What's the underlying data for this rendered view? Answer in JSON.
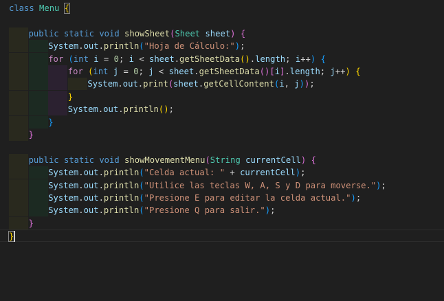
{
  "editor": {
    "language": "java",
    "colors": {
      "background": "#1f1f1f",
      "keyword": "#569cd6",
      "control": "#c586c0",
      "type": "#4ec9b0",
      "function": "#dcdcaa",
      "variable": "#9cdcfe",
      "string": "#ce9178",
      "number": "#b5cea8",
      "bracket_level_1": "#ffd700",
      "bracket_level_2": "#da70d6",
      "bracket_level_3": "#179fff"
    },
    "lines": [
      {
        "tokens": [
          [
            "kw",
            "class"
          ],
          [
            "pl",
            " "
          ],
          [
            "cls",
            "Menu"
          ],
          [
            "pl",
            " "
          ],
          [
            "bb1",
            "{"
          ]
        ]
      },
      {
        "tokens": []
      },
      {
        "tokens": [
          [
            "kw",
            "public"
          ],
          [
            "pl",
            " "
          ],
          [
            "kw",
            "static"
          ],
          [
            "pl",
            " "
          ],
          [
            "kw",
            "void"
          ],
          [
            "pl",
            " "
          ],
          [
            "fn",
            "showSheet"
          ],
          [
            "b2",
            "("
          ],
          [
            "ty",
            "Sheet"
          ],
          [
            "pl",
            " "
          ],
          [
            "var",
            "sheet"
          ],
          [
            "b2",
            ")"
          ],
          [
            "pl",
            " "
          ],
          [
            "b2",
            "{"
          ]
        ]
      },
      {
        "tokens": [
          [
            "var",
            "System"
          ],
          [
            "pl",
            "."
          ],
          [
            "var",
            "out"
          ],
          [
            "pl",
            "."
          ],
          [
            "fn",
            "println"
          ],
          [
            "b3",
            "("
          ],
          [
            "str",
            "\"Hoja de Cálculo:\""
          ],
          [
            "b3",
            ")"
          ],
          [
            "pl",
            ";"
          ]
        ]
      },
      {
        "tokens": [
          [
            "ctl",
            "for"
          ],
          [
            "pl",
            " "
          ],
          [
            "b3",
            "("
          ],
          [
            "kw",
            "int"
          ],
          [
            "pl",
            " "
          ],
          [
            "var",
            "i"
          ],
          [
            "pl",
            " = "
          ],
          [
            "num",
            "0"
          ],
          [
            "pl",
            "; "
          ],
          [
            "var",
            "i"
          ],
          [
            "pl",
            " < "
          ],
          [
            "var",
            "sheet"
          ],
          [
            "pl",
            "."
          ],
          [
            "fn",
            "getSheetData"
          ],
          [
            "b1",
            "()"
          ],
          [
            "pl",
            "."
          ],
          [
            "var",
            "length"
          ],
          [
            "pl",
            "; "
          ],
          [
            "var",
            "i"
          ],
          [
            "pl",
            "++"
          ],
          [
            "b3",
            ")"
          ],
          [
            "pl",
            " "
          ],
          [
            "b3",
            "{"
          ]
        ]
      },
      {
        "tokens": [
          [
            "ctl",
            "for"
          ],
          [
            "pl",
            " "
          ],
          [
            "b1",
            "("
          ],
          [
            "kw",
            "int"
          ],
          [
            "pl",
            " "
          ],
          [
            "var",
            "j"
          ],
          [
            "pl",
            " = "
          ],
          [
            "num",
            "0"
          ],
          [
            "pl",
            "; "
          ],
          [
            "var",
            "j"
          ],
          [
            "pl",
            " < "
          ],
          [
            "var",
            "sheet"
          ],
          [
            "pl",
            "."
          ],
          [
            "fn",
            "getSheetData"
          ],
          [
            "b2",
            "()"
          ],
          [
            "b2",
            "["
          ],
          [
            "var",
            "i"
          ],
          [
            "b2",
            "]"
          ],
          [
            "pl",
            "."
          ],
          [
            "var",
            "length"
          ],
          [
            "pl",
            "; "
          ],
          [
            "var",
            "j"
          ],
          [
            "pl",
            "++"
          ],
          [
            "b1",
            ")"
          ],
          [
            "pl",
            " "
          ],
          [
            "b1",
            "{"
          ]
        ]
      },
      {
        "tokens": [
          [
            "var",
            "System"
          ],
          [
            "pl",
            "."
          ],
          [
            "var",
            "out"
          ],
          [
            "pl",
            "."
          ],
          [
            "fn",
            "print"
          ],
          [
            "b2",
            "("
          ],
          [
            "var",
            "sheet"
          ],
          [
            "pl",
            "."
          ],
          [
            "fn",
            "getCellContent"
          ],
          [
            "b3",
            "("
          ],
          [
            "var",
            "i"
          ],
          [
            "pl",
            ", "
          ],
          [
            "var",
            "j"
          ],
          [
            "b3",
            ")"
          ],
          [
            "b2",
            ")"
          ],
          [
            "pl",
            ";"
          ]
        ]
      },
      {
        "tokens": [
          [
            "b1",
            "}"
          ]
        ]
      },
      {
        "tokens": [
          [
            "var",
            "System"
          ],
          [
            "pl",
            "."
          ],
          [
            "var",
            "out"
          ],
          [
            "pl",
            "."
          ],
          [
            "fn",
            "println"
          ],
          [
            "b1",
            "()"
          ],
          [
            "pl",
            ";"
          ]
        ]
      },
      {
        "tokens": [
          [
            "b3",
            "}"
          ]
        ]
      },
      {
        "tokens": [
          [
            "b2",
            "}"
          ]
        ]
      },
      {
        "tokens": []
      },
      {
        "tokens": [
          [
            "kw",
            "public"
          ],
          [
            "pl",
            " "
          ],
          [
            "kw",
            "static"
          ],
          [
            "pl",
            " "
          ],
          [
            "kw",
            "void"
          ],
          [
            "pl",
            " "
          ],
          [
            "fn",
            "showMovementMenu"
          ],
          [
            "b2",
            "("
          ],
          [
            "ty",
            "String"
          ],
          [
            "pl",
            " "
          ],
          [
            "var",
            "currentCell"
          ],
          [
            "b2",
            ")"
          ],
          [
            "pl",
            " "
          ],
          [
            "b2",
            "{"
          ]
        ]
      },
      {
        "tokens": [
          [
            "var",
            "System"
          ],
          [
            "pl",
            "."
          ],
          [
            "var",
            "out"
          ],
          [
            "pl",
            "."
          ],
          [
            "fn",
            "println"
          ],
          [
            "b3",
            "("
          ],
          [
            "str",
            "\"Celda actual: \""
          ],
          [
            "pl",
            " + "
          ],
          [
            "var",
            "currentCell"
          ],
          [
            "b3",
            ")"
          ],
          [
            "pl",
            ";"
          ]
        ]
      },
      {
        "tokens": [
          [
            "var",
            "System"
          ],
          [
            "pl",
            "."
          ],
          [
            "var",
            "out"
          ],
          [
            "pl",
            "."
          ],
          [
            "fn",
            "println"
          ],
          [
            "b3",
            "("
          ],
          [
            "str",
            "\"Utilice las teclas W, A, S y D para moverse.\""
          ],
          [
            "b3",
            ")"
          ],
          [
            "pl",
            ";"
          ]
        ]
      },
      {
        "tokens": [
          [
            "var",
            "System"
          ],
          [
            "pl",
            "."
          ],
          [
            "var",
            "out"
          ],
          [
            "pl",
            "."
          ],
          [
            "fn",
            "println"
          ],
          [
            "b3",
            "("
          ],
          [
            "str",
            "\"Presione E para editar la celda actual.\""
          ],
          [
            "b3",
            ")"
          ],
          [
            "pl",
            ";"
          ]
        ]
      },
      {
        "tokens": [
          [
            "var",
            "System"
          ],
          [
            "pl",
            "."
          ],
          [
            "var",
            "out"
          ],
          [
            "pl",
            "."
          ],
          [
            "fn",
            "println"
          ],
          [
            "b3",
            "("
          ],
          [
            "str",
            "\"Presione Q para salir.\""
          ],
          [
            "b3",
            ")"
          ],
          [
            "pl",
            ";"
          ]
        ]
      },
      {
        "tokens": [
          [
            "b2",
            "}"
          ]
        ]
      },
      {
        "tokens": [
          [
            "bb1",
            "}"
          ]
        ]
      }
    ]
  }
}
